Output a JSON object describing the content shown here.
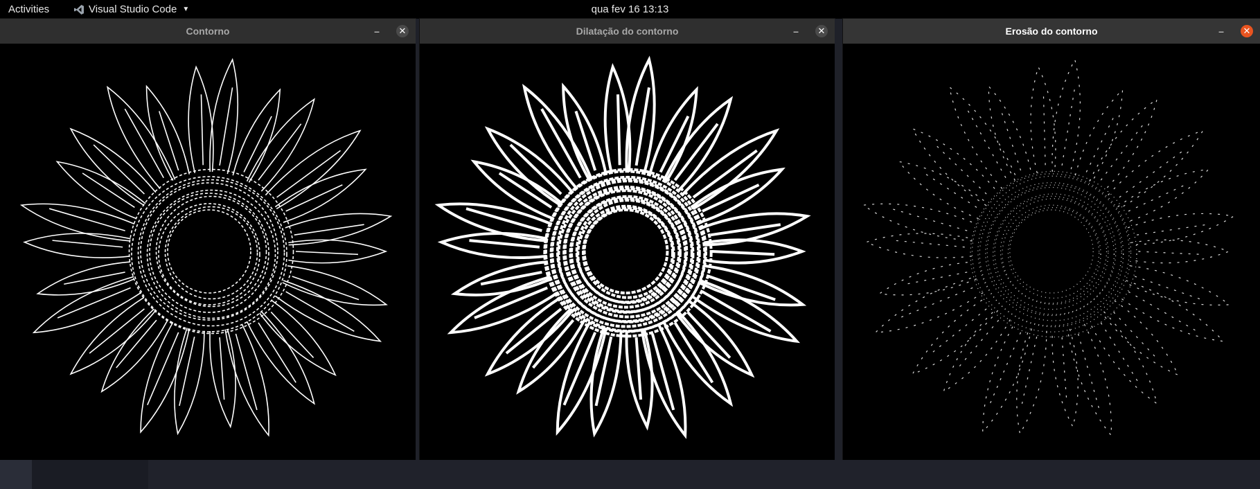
{
  "topbar": {
    "activities_label": "Activities",
    "app_name": "Visual Studio Code",
    "clock": "qua fev 16  13:13"
  },
  "windows": [
    {
      "title": "Contorno",
      "image": "sunflower-edges-thin"
    },
    {
      "title": "Dilatação do contorno",
      "image": "sunflower-edges-dilated"
    },
    {
      "title": "Erosão do contorno",
      "image": "sunflower-edges-eroded"
    }
  ],
  "colors": {
    "accent_close": "#e95420",
    "titlebar": "#2f2f2f",
    "topbar": "#000000"
  }
}
